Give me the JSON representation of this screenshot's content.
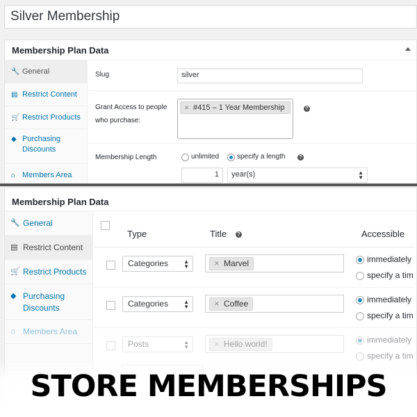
{
  "title_input": "Silver Membership",
  "panel_title": "Membership Plan Data",
  "top_tabs": [
    {
      "label": "General",
      "icon": "wrench-icon",
      "glyph": "🔧"
    },
    {
      "label": "Restrict Content",
      "icon": "content-icon",
      "glyph": "▤"
    },
    {
      "label": "Restrict Products",
      "icon": "cart-icon",
      "glyph": "🛒"
    },
    {
      "label": "Purchasing Discounts",
      "icon": "tag-icon",
      "glyph": "◆"
    },
    {
      "label": "Members Area",
      "icon": "home-icon",
      "glyph": "⌂"
    }
  ],
  "general": {
    "slug_label": "Slug",
    "slug_value": "silver",
    "grant_label": "Grant Access to people who purchase:",
    "grant_chip": "#415 – 1 Year Membership",
    "length_label": "Membership Length",
    "opt_unlimited": "unlimited",
    "opt_specify": "specify a length",
    "length_value": "1",
    "length_unit": "year(s)"
  },
  "bottom_tabs": [
    {
      "label": "General",
      "icon": "wrench-icon",
      "glyph": "🔧"
    },
    {
      "label": "Restrict Content",
      "icon": "content-icon",
      "glyph": "▤"
    },
    {
      "label": "Restrict Products",
      "icon": "cart-icon",
      "glyph": "🛒"
    },
    {
      "label": "Purchasing Discounts",
      "icon": "tag-icon",
      "glyph": "◆"
    },
    {
      "label": "Members Area",
      "icon": "home-icon",
      "glyph": "⌂"
    }
  ],
  "grid": {
    "col_type": "Type",
    "col_title": "Title",
    "col_accessible": "Accessible",
    "rows": [
      {
        "type": "Categories",
        "title": "Marvel",
        "opt1": "immediately",
        "opt2": "specify a tim"
      },
      {
        "type": "Categories",
        "title": "Coffee",
        "opt1": "immediately",
        "opt2": "specify a tim"
      },
      {
        "type": "Posts",
        "title": "Hello world!",
        "opt1": "immediately",
        "opt2": "specify a tim"
      }
    ]
  },
  "banner": "STORE MEMBERSHIPS",
  "colors": {
    "link": "#0073aa",
    "radio": "#1e8cbe"
  }
}
